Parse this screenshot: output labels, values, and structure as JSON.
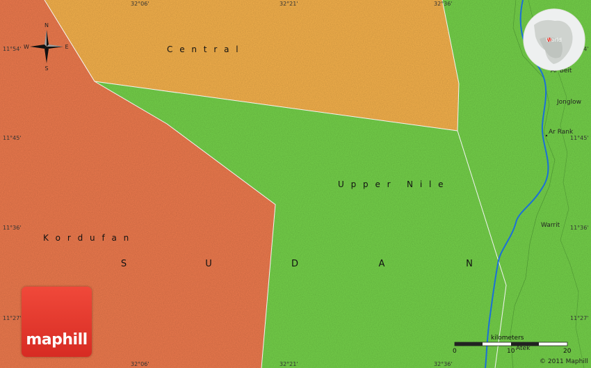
{
  "coordinates": {
    "top": [
      "32°06'",
      "32°21'",
      "32°36'"
    ],
    "bottom": [
      "32°06'",
      "32°21'",
      "32°36'"
    ],
    "left": [
      "11°54'",
      "11°45'",
      "11°36'",
      "11°27'"
    ],
    "right": [
      "11°54'",
      "11°45'",
      "11°36'",
      "11°27'"
    ]
  },
  "compass": {
    "n": "N",
    "s": "S",
    "e": "E",
    "w": "W"
  },
  "regions": {
    "central": "C e n t r a l",
    "upper_nile": "U p p e r   N i l e",
    "kordufan": "K o r d u f a n"
  },
  "country_letters": [
    "S",
    "U",
    "D",
    "A",
    "N"
  ],
  "places": [
    "Ar Beit",
    "Jonglow",
    "Ar Rank",
    "Warrit",
    "Atek"
  ],
  "scale": {
    "title": "kilometers",
    "ticks": [
      "0",
      "10",
      "20"
    ]
  },
  "copyright": "© 2011 Maphill",
  "logo": "maphill",
  "globe_label": "World",
  "colors": {
    "kordufan": "#ef7b4e",
    "central": "#f6b24c",
    "upper_nile": "#75d24a",
    "river": "#1b6fd8",
    "logo": "#e23a2f"
  }
}
